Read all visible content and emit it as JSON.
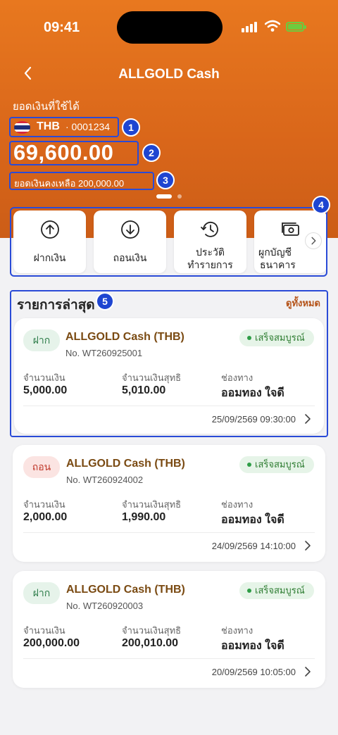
{
  "status": {
    "time": "09:41"
  },
  "header": {
    "title": "ALLGOLD Cash"
  },
  "balance": {
    "available_label": "ยอดเงินที่ใช้ได้",
    "currency": "THB",
    "account_no": "· 0001234",
    "amount": "69,600.00",
    "remaining_text": "ยอดเงินคงเหลือ  200,000.00"
  },
  "annotations": [
    "1",
    "2",
    "3",
    "4",
    "5"
  ],
  "menu": {
    "items": [
      {
        "label": "ฝากเงิน",
        "icon": "arrow-up-circle-icon"
      },
      {
        "label": "ถอนเงิน",
        "icon": "arrow-down-circle-icon"
      },
      {
        "label_line1": "ประวัติ",
        "label_line2": "ทำรายการ",
        "icon": "history-icon"
      },
      {
        "label_line1": "ผูกบัญชี",
        "label_line2": "ธนาคาร",
        "icon": "banknote-icon"
      }
    ]
  },
  "recent": {
    "title": "รายการล่าสุด",
    "see_all": "ดูทั้งหมด",
    "col_amount": "จำนวนเงิน",
    "col_net": "จำนวนเงินสุทธิ",
    "col_channel": "ช่องทาง",
    "transactions": [
      {
        "tag": "ฝาก",
        "name": "ALLGOLD Cash (THB)",
        "no": "No. WT260925001",
        "status": "เสร็จสมบูรณ์",
        "amount": "5,000.00",
        "net": "5,010.00",
        "channel": "ออมทอง ใจดี",
        "date": "25/09/2569 09:30:00"
      },
      {
        "tag": "ถอน",
        "name": "ALLGOLD Cash (THB)",
        "no": "No. WT260924002",
        "status": "เสร็จสมบูรณ์",
        "amount": "2,000.00",
        "net": "1,990.00",
        "channel": "ออมทอง ใจดี",
        "date": "24/09/2569 14:10:00"
      },
      {
        "tag": "ฝาก",
        "name": "ALLGOLD Cash (THB)",
        "no": "No. WT260920003",
        "status": "เสร็จสมบูรณ์",
        "amount": "200,000.00",
        "net": "200,010.00",
        "channel": "ออมทอง ใจดี",
        "date": "20/09/2569 10:05:00"
      }
    ]
  },
  "colors": {
    "primary": "#d9661a",
    "annotation": "#1e45d1",
    "success": "#2e7d32",
    "withdraw": "#c0392b",
    "brand_text": "#7a4a12"
  }
}
